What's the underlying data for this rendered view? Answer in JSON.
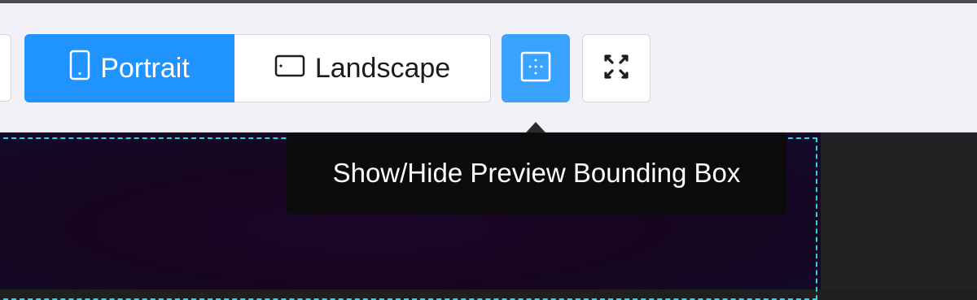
{
  "toolbar": {
    "orientation": {
      "portrait_label": "Portrait",
      "landscape_label": "Landscape",
      "selected": "Portrait"
    },
    "bounding_box_button": {
      "icon": "bounding-box-icon",
      "active": true
    },
    "fullscreen_button": {
      "icon": "expand-icon"
    }
  },
  "tooltip": {
    "text": "Show/Hide Preview Bounding Box"
  },
  "colors": {
    "accent": "#1f93ff",
    "toolbar_bg": "#f3f1f8",
    "preview_bounds": "#29d6e4",
    "tooltip_bg": "#0b0a0d"
  }
}
